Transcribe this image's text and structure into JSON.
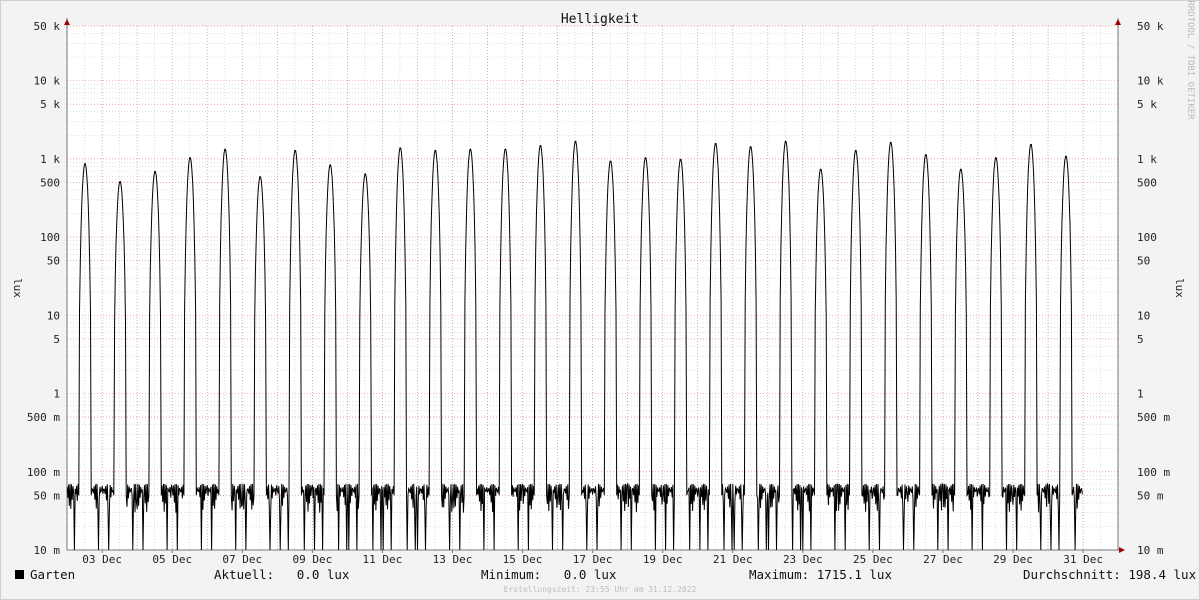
{
  "chart_data": {
    "type": "line",
    "title": "Helligkeit",
    "ylabel": "lux",
    "ylabel_right": "lux",
    "y_scale": "log",
    "ylim": [
      0.01,
      50000
    ],
    "xlim": [
      "2022-12-01T23:55",
      "2022-12-31T23:55"
    ],
    "y_ticks": [
      {
        "value": 50000,
        "label": "50 k"
      },
      {
        "value": 10000,
        "label": "10 k"
      },
      {
        "value": 5000,
        "label": "5 k"
      },
      {
        "value": 1000,
        "label": "1 k"
      },
      {
        "value": 500,
        "label": "500"
      },
      {
        "value": 100,
        "label": "100"
      },
      {
        "value": 50,
        "label": "50"
      },
      {
        "value": 10,
        "label": "10"
      },
      {
        "value": 5,
        "label": "5"
      },
      {
        "value": 1,
        "label": "1"
      },
      {
        "value": 0.5,
        "label": "500 m"
      },
      {
        "value": 0.1,
        "label": "100 m"
      },
      {
        "value": 0.05,
        "label": "50 m"
      },
      {
        "value": 0.01,
        "label": "10 m"
      }
    ],
    "x_ticks": [
      "03 Dec",
      "05 Dec",
      "07 Dec",
      "09 Dec",
      "11 Dec",
      "13 Dec",
      "15 Dec",
      "17 Dec",
      "19 Dec",
      "21 Dec",
      "23 Dec",
      "25 Dec",
      "27 Dec",
      "29 Dec",
      "31 Dec"
    ],
    "grid": true,
    "series": [
      {
        "name": "Garten",
        "color": "#000000",
        "daily_peak_lux": [
          900,
          880,
          520,
          700,
          1050,
          1350,
          600,
          1300,
          850,
          650,
          1400,
          1300,
          1350,
          1350,
          1500,
          1700,
          950,
          1050,
          1000,
          1600,
          1450,
          1700,
          750,
          1300,
          1650,
          1150,
          750,
          1050,
          1550,
          1100
        ],
        "night_level_lux": 0.05
      }
    ]
  },
  "legend": {
    "series_name": "Garten",
    "current": "Aktuell:   0.0 lux",
    "minimum": "Minimum:   0.0 lux",
    "maximum": "Maximum: 1715.1 lux",
    "average": "Durchschnitt: 198.4 lux"
  },
  "watermark": "RRDTOOL / TOBI OETIKER",
  "footer": "Erstellungszeit: 23:55 Uhr am 31.12.2022",
  "colors": {
    "major_grid": "#e08a8a",
    "minor_grid": "#c9c9c9",
    "axis": "#777777",
    "arrow": "#a00000",
    "line": "#000000"
  }
}
